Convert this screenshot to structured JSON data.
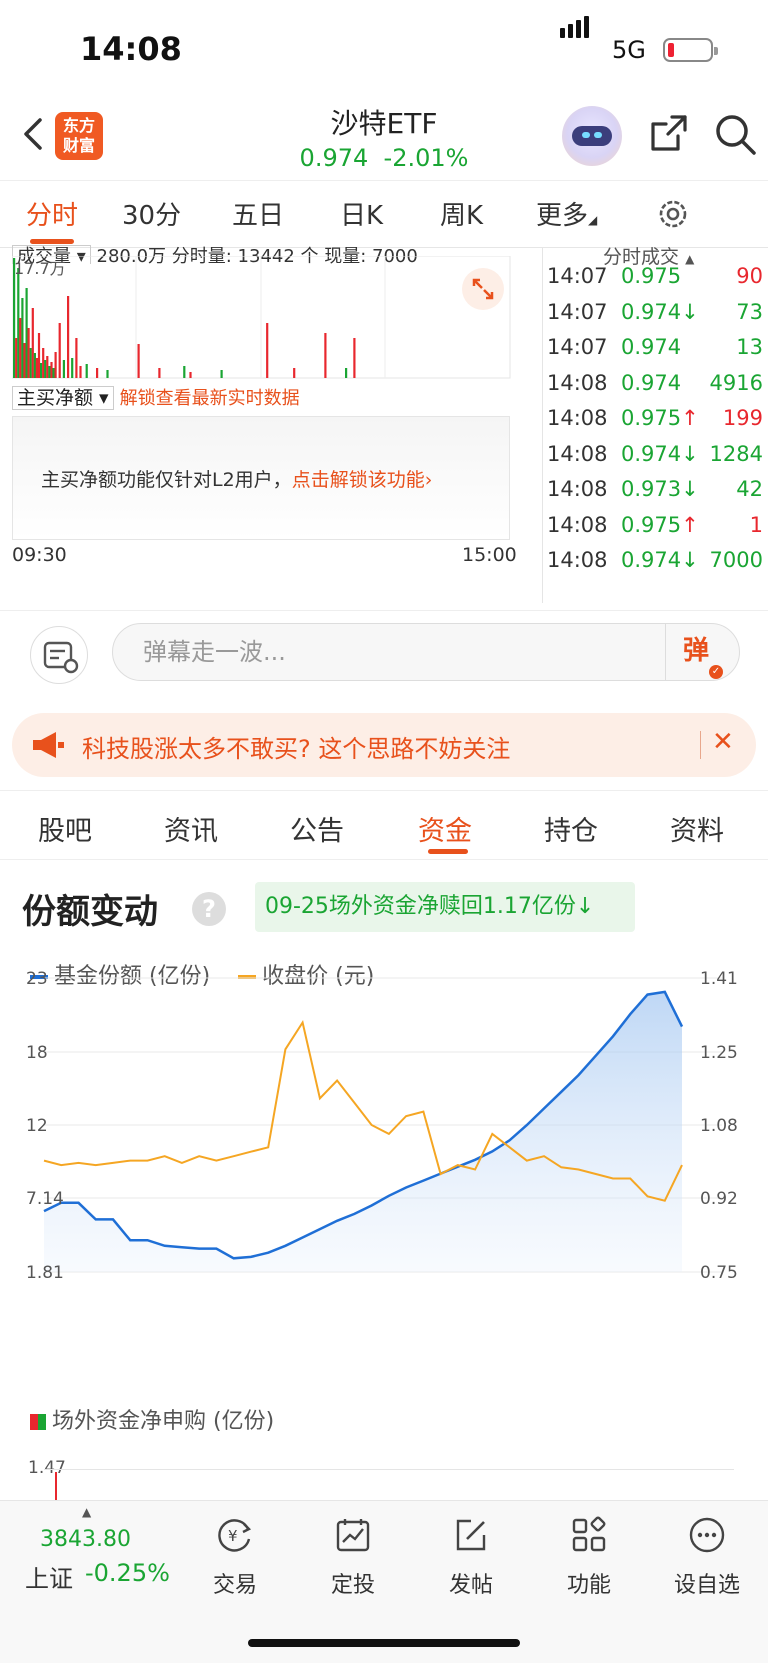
{
  "status_bar": {
    "time": "14:08",
    "network": "5G"
  },
  "header": {
    "logo_line1": "东方",
    "logo_line2": "财富",
    "title": "沙特ETF",
    "price": "0.974",
    "change_pct": "-2.01%",
    "price_color": "#1aa533"
  },
  "period_tabs": [
    "分时",
    "30分",
    "五日",
    "日K",
    "周K",
    "更多"
  ],
  "active_tab": "分时",
  "intraday": {
    "volume_selector": "成交量",
    "volume_header": "280.0万 分时量: 13442 个 现量: 7000",
    "volume_max_label": "17.7万",
    "flow_selector": "主买净额",
    "unlock_link": "解锁查看最新实时数据",
    "l2_notice_text": "主买净额功能仅针对L2用户，",
    "l2_notice_link": "点击解锁该功能",
    "time_start": "09:30",
    "time_end": "15:00",
    "volume_bars": [
      {
        "min": 0,
        "h": 120,
        "c": "g"
      },
      {
        "min": 1,
        "h": 40,
        "c": "r"
      },
      {
        "min": 2,
        "h": 110,
        "c": "g"
      },
      {
        "min": 3,
        "h": 60,
        "c": "r"
      },
      {
        "min": 4,
        "h": 80,
        "c": "g"
      },
      {
        "min": 5,
        "h": 35,
        "c": "r"
      },
      {
        "min": 6,
        "h": 90,
        "c": "g"
      },
      {
        "min": 7,
        "h": 50,
        "c": "r"
      },
      {
        "min": 8,
        "h": 30,
        "c": "g"
      },
      {
        "min": 9,
        "h": 70,
        "c": "r"
      },
      {
        "min": 10,
        "h": 25,
        "c": "g"
      },
      {
        "min": 11,
        "h": 20,
        "c": "r"
      },
      {
        "min": 12,
        "h": 45,
        "c": "r"
      },
      {
        "min": 13,
        "h": 15,
        "c": "g"
      },
      {
        "min": 14,
        "h": 30,
        "c": "r"
      },
      {
        "min": 15,
        "h": 18,
        "c": "g"
      },
      {
        "min": 16,
        "h": 22,
        "c": "r"
      },
      {
        "min": 17,
        "h": 12,
        "c": "g"
      },
      {
        "min": 18,
        "h": 16,
        "c": "r"
      },
      {
        "min": 19,
        "h": 10,
        "c": "g"
      },
      {
        "min": 20,
        "h": 26,
        "c": "r"
      },
      {
        "min": 22,
        "h": 55,
        "c": "r"
      },
      {
        "min": 24,
        "h": 18,
        "c": "g"
      },
      {
        "min": 26,
        "h": 82,
        "c": "r"
      },
      {
        "min": 28,
        "h": 20,
        "c": "g"
      },
      {
        "min": 30,
        "h": 40,
        "c": "r"
      },
      {
        "min": 32,
        "h": 12,
        "c": "r"
      },
      {
        "min": 35,
        "h": 14,
        "c": "g"
      },
      {
        "min": 40,
        "h": 10,
        "c": "r"
      },
      {
        "min": 45,
        "h": 8,
        "c": "g"
      },
      {
        "min": 60,
        "h": 34,
        "c": "r"
      },
      {
        "min": 70,
        "h": 10,
        "c": "r"
      },
      {
        "min": 82,
        "h": 12,
        "c": "g"
      },
      {
        "min": 85,
        "h": 6,
        "c": "r"
      },
      {
        "min": 100,
        "h": 8,
        "c": "g"
      },
      {
        "min": 122,
        "h": 55,
        "c": "r"
      },
      {
        "min": 135,
        "h": 10,
        "c": "r"
      },
      {
        "min": 150,
        "h": 45,
        "c": "r"
      },
      {
        "min": 160,
        "h": 10,
        "c": "g"
      },
      {
        "min": 164,
        "h": 40,
        "c": "r"
      }
    ],
    "ticks_header": "分时成交",
    "ticks": [
      {
        "time": "14:07",
        "price": "0.975",
        "arrow": "",
        "volume": "90",
        "pc": "#1aa533",
        "vc": "#e8272e"
      },
      {
        "time": "14:07",
        "price": "0.974",
        "arrow": "↓",
        "volume": "73",
        "pc": "#1aa533",
        "vc": "#1aa533"
      },
      {
        "time": "14:07",
        "price": "0.974",
        "arrow": "",
        "volume": "13",
        "pc": "#1aa533",
        "vc": "#1aa533"
      },
      {
        "time": "14:08",
        "price": "0.974",
        "arrow": "",
        "volume": "4916",
        "pc": "#1aa533",
        "vc": "#1aa533"
      },
      {
        "time": "14:08",
        "price": "0.975",
        "arrow": "↑",
        "volume": "199",
        "pc": "#1aa533",
        "vc": "#e8272e"
      },
      {
        "time": "14:08",
        "price": "0.974",
        "arrow": "↓",
        "volume": "1284",
        "pc": "#1aa533",
        "vc": "#1aa533"
      },
      {
        "time": "14:08",
        "price": "0.973",
        "arrow": "↓",
        "volume": "42",
        "pc": "#1aa533",
        "vc": "#1aa533"
      },
      {
        "time": "14:08",
        "price": "0.975",
        "arrow": "↑",
        "volume": "1",
        "pc": "#1aa533",
        "vc": "#e8272e"
      },
      {
        "time": "14:08",
        "price": "0.974",
        "arrow": "↓",
        "volume": "7000",
        "pc": "#1aa533",
        "vc": "#1aa533"
      }
    ]
  },
  "danmaku": {
    "placeholder": "弹幕走一波...",
    "button": "弹"
  },
  "notice": {
    "text": "科技股涨太多不敢买? 这个思路不妨关注",
    "close": "✕"
  },
  "section_tabs": [
    "股吧",
    "资讯",
    "公告",
    "资金",
    "持仓",
    "资料"
  ],
  "active_section": "资金",
  "fund": {
    "title": "份额变动",
    "help": "?",
    "net_tag": "09-25场外资金净赎回1.17亿份",
    "net_arrow": "↓",
    "legend_shares": "基金份额 (亿份)",
    "legend_price": "收盘价 (元)",
    "shares_color": "#1f6fd6",
    "price_color": "#f5a623",
    "subscription_title": "场外资金净申购 (亿份)",
    "subscription_max": "1.47"
  },
  "chart_data": {
    "type": "line",
    "left_axis": {
      "labels": [
        "23",
        "18",
        "12",
        "7.14",
        "1.81"
      ],
      "ylim": [
        1.81,
        23
      ]
    },
    "right_axis": {
      "labels": [
        "1.41",
        "1.25",
        "1.08",
        "0.92",
        "0.75"
      ],
      "ylim": [
        0.75,
        1.41
      ]
    },
    "series": [
      {
        "name": "基金份额 (亿份)",
        "axis": "left",
        "values": [
          6.2,
          6.8,
          6.8,
          5.6,
          5.6,
          4.1,
          4.1,
          3.7,
          3.6,
          3.5,
          3.5,
          2.8,
          2.9,
          3.2,
          3.7,
          4.3,
          4.9,
          5.5,
          6.0,
          6.6,
          7.3,
          7.9,
          8.4,
          8.9,
          9.4,
          9.9,
          10.5,
          11.3,
          12.4,
          13.6,
          14.8,
          16.0,
          17.4,
          18.8,
          20.4,
          21.8,
          22.0,
          19.5
        ]
      },
      {
        "name": "收盘价 (元)",
        "axis": "right",
        "values": [
          1.0,
          0.99,
          0.995,
          0.99,
          0.995,
          1.0,
          1.0,
          1.01,
          0.995,
          1.01,
          1.0,
          1.01,
          1.02,
          1.03,
          1.25,
          1.31,
          1.14,
          1.18,
          1.13,
          1.08,
          1.06,
          1.1,
          1.11,
          0.97,
          0.99,
          0.98,
          1.06,
          1.03,
          1.0,
          1.01,
          0.985,
          0.98,
          0.97,
          0.96,
          0.96,
          0.92,
          0.91,
          0.99
        ]
      }
    ],
    "subscription": {
      "name": "场外资金净申购 (亿份)",
      "ylim_max": 1.47
    }
  },
  "bottom_bar": {
    "index_value": "3843.80",
    "index_name": "上证",
    "index_change": "-0.25%",
    "items": [
      "交易",
      "定投",
      "发帖",
      "功能",
      "设自选"
    ]
  }
}
